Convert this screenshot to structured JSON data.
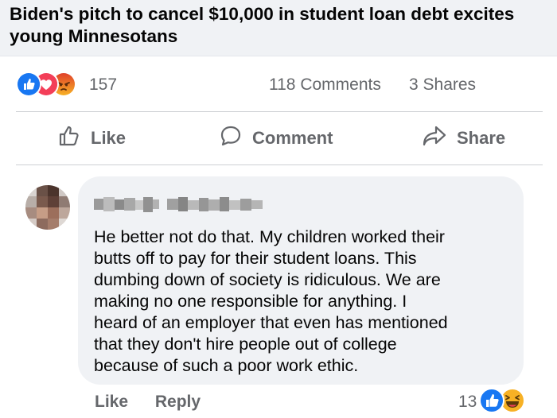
{
  "post": {
    "headline": "Biden's pitch to cancel $10,000 in student loan debt excites young Minnesotans"
  },
  "stats": {
    "reaction_icons": [
      "like-icon",
      "love-icon",
      "angry-icon"
    ],
    "reaction_count": "157",
    "comments": "118 Comments",
    "shares": "3 Shares"
  },
  "actions": {
    "like": "Like",
    "comment": "Comment",
    "share": "Share"
  },
  "comment": {
    "author": "",
    "text": "He better not do that.  My children worked their\nbutts off to pay for their student loans.  This\ndumbing down of society is ridiculous.  We are\nmaking no one responsible for anything.  I\nheard of an employer that even has mentioned\nthat they don't hire people out of college\nbecause of such a poor work ethic.",
    "like": "Like",
    "reply": "Reply",
    "reaction_count": "13",
    "reaction_icons": [
      "like-icon",
      "haha-icon"
    ]
  },
  "colors": {
    "like_blue": "#1877f2",
    "love_red": "#f33e58",
    "angry_orange": "#e9710f",
    "haha_yellow": "#f7b125",
    "muted_text": "#65676b",
    "bubble_bg": "#f0f2f5"
  }
}
